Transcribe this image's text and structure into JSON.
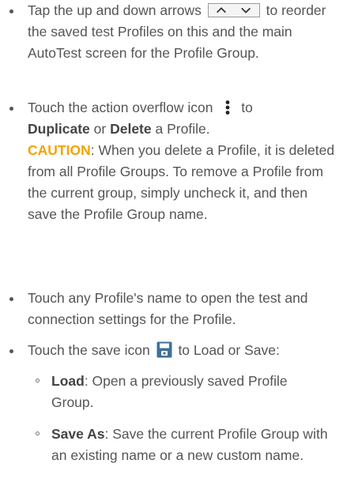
{
  "items": [
    {
      "pre": "Tap the up and down arrows",
      "icon": "up-down-arrows-icon",
      "post": "to reorder the saved test Profiles on this and the main AutoTest screen for the Profile Group."
    },
    {
      "pre": "Touch the action overflow icon",
      "icon": "action-overflow-icon",
      "post": "to",
      "bold1": "Duplicate",
      "mid": "or",
      "bold2": "Delete",
      "tail": "a Profile.",
      "caution_label": "CAUTION",
      "caution_text": ": When you delete a Profile, it is deleted from all Profile Groups. To remove a Profile from the current group, simply uncheck it, and then save the Profile Group name."
    },
    {
      "text": "Touch any Profile's name to open the test and connection settings for the Profile."
    },
    {
      "pre": "Touch the save icon",
      "icon": "save-icon",
      "post": "to Load or Save:",
      "subitems": [
        {
          "label": "Load",
          "text": ": Open a previously saved Profile Group."
        },
        {
          "label": "Save As",
          "text": ": Save the current Profile Group with an existing name or a new custom name."
        }
      ]
    }
  ],
  "colors": {
    "text": "#555555",
    "caution": "#f5a300",
    "save_icon": "#3f6f99"
  }
}
